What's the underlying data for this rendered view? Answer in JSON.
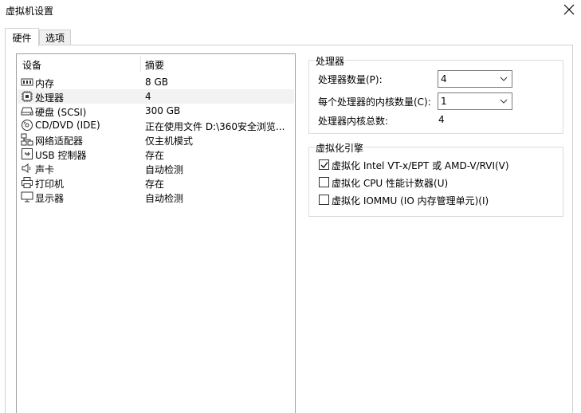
{
  "window": {
    "title": "虚拟机设置"
  },
  "tabs": [
    {
      "label": "硬件",
      "active": true
    },
    {
      "label": "选项",
      "active": false
    }
  ],
  "device_list": {
    "headers": {
      "device": "设备",
      "summary": "摘要"
    },
    "rows": [
      {
        "icon": "memory-icon",
        "device": "内存",
        "summary": "8 GB"
      },
      {
        "icon": "processor-icon",
        "device": "处理器",
        "summary": "4",
        "selected": true
      },
      {
        "icon": "hard-disk-icon",
        "device": "硬盘 (SCSI)",
        "summary": "300 GB"
      },
      {
        "icon": "cd-dvd-icon",
        "device": "CD/DVD (IDE)",
        "summary": "正在使用文件 D:\\360安全浏览..."
      },
      {
        "icon": "network-adapter-icon",
        "device": "网络适配器",
        "summary": "仅主机模式"
      },
      {
        "icon": "usb-icon",
        "device": "USB 控制器",
        "summary": "存在"
      },
      {
        "icon": "sound-card-icon",
        "device": "声卡",
        "summary": "自动检测"
      },
      {
        "icon": "printer-icon",
        "device": "打印机",
        "summary": "存在"
      },
      {
        "icon": "display-icon",
        "device": "显示器",
        "summary": "自动检测"
      }
    ]
  },
  "processor_group": {
    "title": "处理器",
    "count_label": "处理器数量(P):",
    "count_value": "4",
    "cores_label": "每个处理器的内核数量(C):",
    "cores_value": "1",
    "total_label": "处理器内核总数:",
    "total_value": "4"
  },
  "virtualization_group": {
    "title": "虚拟化引擎",
    "options": [
      {
        "label": "虚拟化 Intel VT-x/EPT 或 AMD-V/RVI(V)",
        "checked": true
      },
      {
        "label": "虚拟化 CPU 性能计数器(U)",
        "checked": false
      },
      {
        "label": "虚拟化 IOMMU (IO 内存管理单元)(I)",
        "checked": false
      }
    ]
  }
}
